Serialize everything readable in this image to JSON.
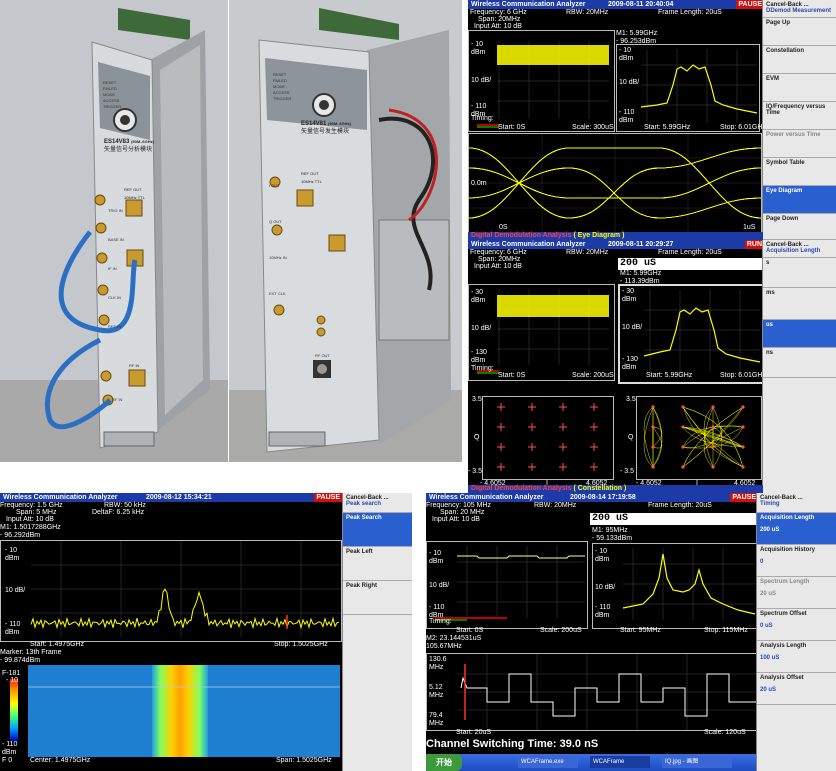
{
  "photos": {
    "left_module": {
      "leds": [
        "RESET",
        "FAILED",
        "MODE",
        "ACCESS",
        "TRIGGER"
      ],
      "model": "ES14V83",
      "model_suffix": "(50M–6GHz)",
      "name": "矢量信号分析模块",
      "ref_out": "REF OUT",
      "ref_out_sub": "10MHz TTL",
      "connectors": [
        "TRIG IN",
        "BASE IN",
        "IF IN",
        "CLK IN",
        "REF IN",
        "RF IN",
        "RF IN"
      ]
    },
    "right_module": {
      "leds": [
        "RESET",
        "FAILED",
        "MODE",
        "ACCESS",
        "TRIGGER"
      ],
      "model": "ES14V81",
      "model_suffix": "(50M–6GHz)",
      "name": "矢量信号发生模块",
      "ref_out": "REF OUT",
      "ref_out_sub": "10MHz TTL",
      "connectors": [
        "I OUT",
        "Q OUT",
        "10MHz IN",
        "EXT CLK",
        "RF OUT"
      ]
    }
  },
  "screens": {
    "eye": {
      "title": "Wireless Communication Analyzer",
      "datetime": "2009-08-11 20:40:04",
      "pause": "PAUSE",
      "frequency": "Frequency: 6  GHz",
      "rbw": "RBW: 20MHz",
      "frame_length": "Frame Length: 20uS",
      "span": "Span: 20MHz",
      "input_att": "Input Att: 10  dB",
      "marker": "M1: 5.99GHz",
      "marker_val": "- 96.253dBm",
      "left_top": "- 10",
      "left_top_u": "dBm",
      "left_mid": "10 dB/",
      "left_bot": "- 110",
      "left_bot_u": "dBm",
      "timing": "Timing:",
      "left_start": "Start: 0S",
      "left_scale": "Scale: 300uS",
      "right_top": "- 10",
      "right_top_u": "dBm",
      "right_mid": "10 dB/",
      "right_bot": "- 110",
      "right_bot_u": "dBm",
      "right_start": "Start: 5.99GHz",
      "right_stop": "Stop: 6.01GHz",
      "eye_ylabel": "0.0m",
      "eye_start": "0S",
      "eye_end": "1uS",
      "menu": [
        {
          "label": "Cancel-Back ...",
          "sub": "DDemod Measurement"
        },
        {
          "label": "Page Up"
        },
        {
          "label": "Constellation"
        },
        {
          "label": "EVM"
        },
        {
          "label": "IQ/Frequency versus Time"
        },
        {
          "label": "Power versus Time"
        },
        {
          "label": "Symbol Table"
        },
        {
          "label": "Eye Diagram"
        },
        {
          "label": "Page Down"
        }
      ],
      "banner": "Digital Demodulation Analysis",
      "banner_hl": "( Eye Diagram )"
    },
    "constellation": {
      "title": "Wireless Communication Analyzer",
      "datetime": "2009-08-11 20:29:27",
      "pause": "RUN",
      "frequency": "Frequency: 6  GHz",
      "rbw": "RBW: 20MHz",
      "frame_length": "Frame Length: 20uS",
      "span": "Span: 20MHz",
      "input_att": "Input Att: 10  dB",
      "entry_value": "200  uS",
      "marker": "M1: 5.99GHz",
      "marker_val": "- 113.39dBm",
      "left_top": "- 30",
      "left_top_u": "dBm",
      "left_mid": "10 dB/",
      "left_bot": "- 130",
      "left_bot_u": "dBm",
      "timing": "Timing:",
      "left_start": "Start: 0S",
      "left_scale": "Scale: 200uS",
      "right_top": "- 30",
      "right_top_u": "dBm",
      "right_mid": "10 dB/",
      "right_bot": "- 130",
      "right_bot_u": "dBm",
      "right_start": "Start: 5.99GHz",
      "right_stop": "Stop: 6.01GHz",
      "c1_top": "3.5",
      "c1_bot": "- 3.5",
      "c1_q": "Q",
      "c1_xl": "- 4.6052",
      "c1_xm": "I",
      "c1_xr": "4.6052",
      "c2_top": "3.5",
      "c2_bot": "- 3.5",
      "c2_q": "Q",
      "c2_xl": "- 4.6052",
      "c2_xm": "I",
      "c2_xr": "4.6052",
      "menu": [
        {
          "label": "Cancel-Back ...",
          "sub": "Acquisition Length"
        },
        {
          "label": "s"
        },
        {
          "label": "ms"
        },
        {
          "label": "us"
        },
        {
          "label": "ns"
        }
      ],
      "banner": "Digital Demodulation Analysis",
      "banner_hl": "( Constellation )"
    },
    "peak": {
      "title": "Wireless Communication Analyzer",
      "datetime": "2009-08-12 15:34:21",
      "pause": "PAUSE",
      "frequency": "Frequency: 1.5  GHz",
      "rbw": "RBW: 50   kHz",
      "span": "Span: 5   MHz",
      "deltaf": "DeltaF: 6.25  kHz",
      "input_att": "Input Att: 10    dB",
      "marker": "M1: 1.5017288GHz",
      "marker_val": "- 96.292dBm",
      "top": "- 10",
      "top_u": "dBm",
      "mid": "10 dB/",
      "bot": "- 110",
      "bot_u": "dBm",
      "start": "Start: 1.4975GHz",
      "stop": "Stop: 1.5025GHz",
      "marker2": "Marker: 13th Frame",
      "marker2_val": "- 99.874dBm",
      "wf_f": "F-181",
      "wf_top": "- 10",
      "wf_bot": "- 110",
      "wf_bot_u": "dBm",
      "wf_f0": "F 0",
      "center": "Center: 1.4975GHz",
      "span2": "Span: 1.5025GHz",
      "menu": [
        {
          "label": "Cancel-Back ...",
          "sub": "Peak search"
        },
        {
          "label": "Peak Search"
        },
        {
          "label": "Peak Left"
        },
        {
          "label": "Peak Right"
        }
      ]
    },
    "switching": {
      "title": "Wireless Communication Analyzer",
      "datetime": "2009-08-14 17:19:58",
      "pause": "PAUSE",
      "frequency": "Frequency: 105 MHz",
      "rbw": "RBW: 20MHz",
      "frame_length": "Frame Length: 20uS",
      "span": "Span: 20  MHz",
      "input_att": "Input Att: 10  dB",
      "entry_value": "200  uS",
      "marker": "M1: 95MHz",
      "marker_val": "- 59.133dBm",
      "left_top": "- 10",
      "left_top_u": "dBm",
      "left_mid": "10 dB/",
      "left_bot": "- 110",
      "left_bot_u": "dBm",
      "timing": "Timing:",
      "left_start": "Start: 0S",
      "left_scale": "Scale: 200uS",
      "right_top": "- 10",
      "right_top_u": "dBm",
      "right_mid": "10 dB/",
      "right_bot": "- 110",
      "right_bot_u": "dBm",
      "right_start": "Start: 95MHz",
      "right_stop": "Stop: 115MHz",
      "m2": "M2: 23.144531uS",
      "m2_val": "105.67MHz",
      "b_top": "130.6",
      "b_top_u": "MHz",
      "b_mid": "5.12",
      "b_mid_u": "MHz",
      "b_bot": "79.4",
      "b_bot_u": "MHz",
      "b_start": "Start: 20uS",
      "b_scale": "Scale: 120uS",
      "switching_time": "Channel Switching Time:  39.0 nS",
      "menu": [
        {
          "label": "Cancel-Back ...",
          "sub": "Timing"
        },
        {
          "label": "Acquisition Length",
          "sub": "200 uS"
        },
        {
          "label": "Acquisition History",
          "sub": "0"
        },
        {
          "label": "Spectrum Length",
          "sub": "20 uS"
        },
        {
          "label": "Spectrum Offset",
          "sub": "0 uS"
        },
        {
          "label": "Analysis Length",
          "sub": "100 uS"
        },
        {
          "label": "Analysis Offset",
          "sub": "20 uS"
        }
      ],
      "taskbar": {
        "start": "开始",
        "tasks": [
          "WCAFrame.exe",
          "WCAFrame",
          "IQ.jpg - 画图"
        ]
      }
    }
  },
  "colors": {
    "trace": "#ffff00",
    "screen_bg": "#000000",
    "titlebar": "#1c3aa8",
    "pause": "#d01010",
    "menu_active": "#2a5fcf",
    "marker": "#ff3030"
  }
}
